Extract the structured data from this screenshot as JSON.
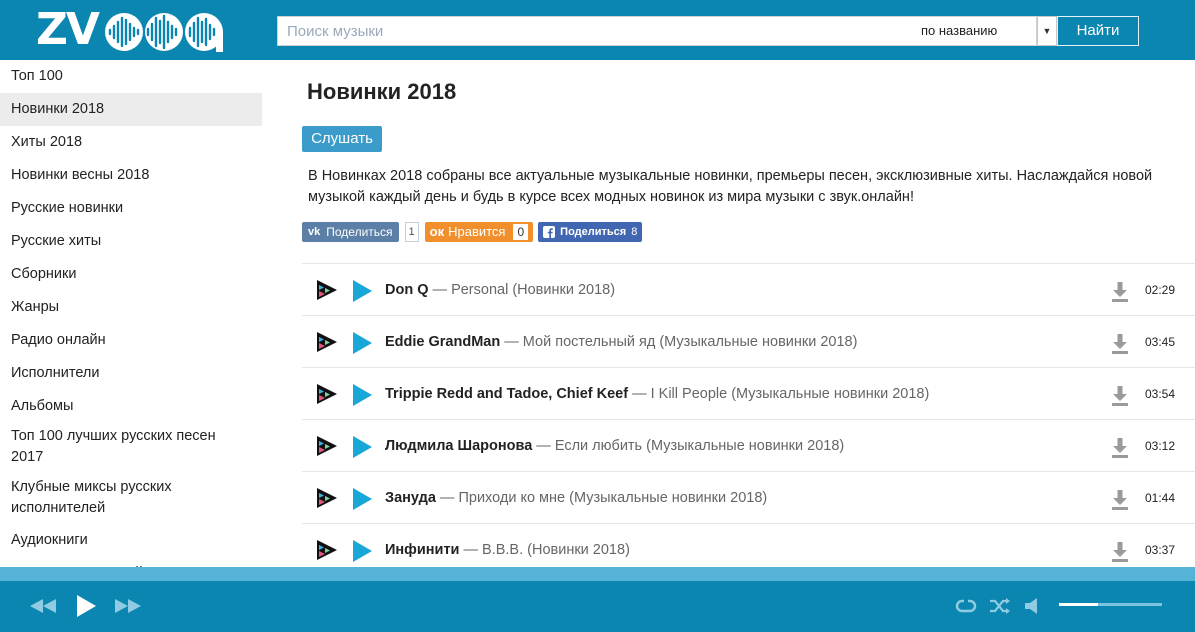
{
  "header": {
    "logo_text": "ZV",
    "logo_tail": "q",
    "search_placeholder": "Поиск музыки",
    "search_mode": "по названию",
    "search_button": "Найти"
  },
  "sidebar": {
    "items": [
      {
        "label": "Топ 100"
      },
      {
        "label": "Новинки 2018",
        "active": true
      },
      {
        "label": "Хиты 2018"
      },
      {
        "label": "Новинки весны 2018"
      },
      {
        "label": "Русские новинки"
      },
      {
        "label": "Русские хиты"
      },
      {
        "label": "Сборники"
      },
      {
        "label": "Жанры"
      },
      {
        "label": "Радио онлайн"
      },
      {
        "label": "Исполнители"
      },
      {
        "label": "Альбомы"
      },
      {
        "label": "Топ 100 лучших русских песен 2017"
      },
      {
        "label": "Клубные миксы русских исполнителей"
      },
      {
        "label": "Аудиокниги"
      },
      {
        "label": "День защиты детей"
      }
    ]
  },
  "main": {
    "title": "Новинки 2018",
    "listen_button": "Слушать",
    "description": "В Новинках 2018 собраны все актуальные музыкальные новинки, премьеры песен, эксклюзивные хиты. Наслаждайся новой музыкой каждый день и будь в курсе всех модных новинок из мира музыки с звук.онлайн!",
    "share": {
      "vk_label": "Поделиться",
      "vk_count": "1",
      "ok_label": "Нравится",
      "ok_count": "0",
      "fb_label": "Поделиться",
      "fb_count": "8"
    },
    "tracks": [
      {
        "artist": "Don Q",
        "title": "Personal (Новинки 2018)",
        "duration": "02:29"
      },
      {
        "artist": "Eddie GrandMan",
        "title": "Мой постельный яд (Музыкальные новинки 2018)",
        "duration": "03:45"
      },
      {
        "artist": "Trippie Redd and Tadoe, Chief Keef",
        "title": "I Kill People (Музыкальные новинки 2018)",
        "duration": "03:54"
      },
      {
        "artist": "Людмила Шаронова",
        "title": "Если любить (Музыкальные новинки 2018)",
        "duration": "03:12"
      },
      {
        "artist": "Зануда",
        "title": "Приходи ко мне (Музыкальные новинки 2018)",
        "duration": "01:44"
      },
      {
        "artist": "Инфинити",
        "title": "B.B.B. (Новинки 2018)",
        "duration": "03:37"
      }
    ]
  },
  "player": {
    "volume_level": 0.38,
    "icons": [
      "prev-icon",
      "play-icon",
      "next-icon",
      "repeat-icon",
      "shuffle-icon",
      "volume-icon"
    ]
  },
  "colors": {
    "brand": "#0a86b0",
    "accent_play": "#19a7d8",
    "ok_orange": "#f18f2c",
    "vk_blue": "#5b7fa6",
    "fb_blue": "#4267b2"
  }
}
